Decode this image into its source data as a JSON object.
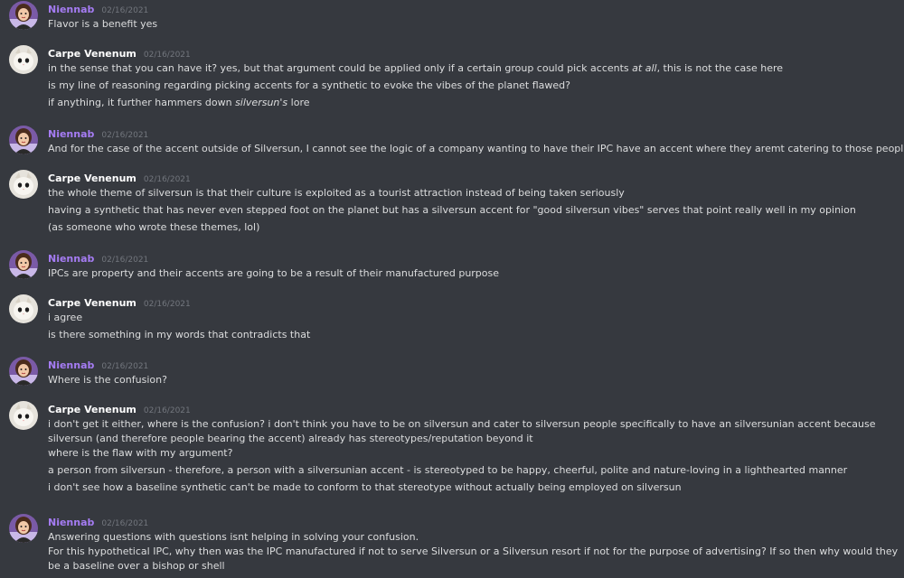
{
  "channel": {
    "messages": [
      {
        "author": "Niennab",
        "author_style": "niennab",
        "timestamp": "02/16/2021",
        "lines": [
          {
            "parts": [
              {
                "text": "Flavor is a benefit yes"
              }
            ]
          }
        ]
      },
      {
        "author": "Carpe Venenum",
        "author_style": "carpe",
        "timestamp": "02/16/2021",
        "lines": [
          {
            "parts": [
              {
                "text": "in the sense that you can have it? yes, but that argument could be applied only if a certain group could pick accents "
              },
              {
                "text": "at all",
                "italic": true
              },
              {
                "text": ", this is not the case here"
              }
            ]
          },
          {
            "parts": [
              {
                "text": "is my line of reasoning regarding picking accents for a synthetic to evoke the vibes of the planet flawed?"
              }
            ]
          },
          {
            "parts": [
              {
                "text": "if anything, it further hammers down "
              },
              {
                "text": "silversun's",
                "italic": true
              },
              {
                "text": " lore"
              }
            ]
          }
        ]
      },
      {
        "author": "Niennab",
        "author_style": "niennab",
        "timestamp": "02/16/2021",
        "lines": [
          {
            "parts": [
              {
                "text": "And for the case of the accent outside of Silversun, I cannot see the logic of a company wanting to have their IPC have an accent where they aremt catering to those people"
              }
            ]
          }
        ]
      },
      {
        "author": "Carpe Venenum",
        "author_style": "carpe",
        "timestamp": "02/16/2021",
        "lines": [
          {
            "parts": [
              {
                "text": "the whole theme of silversun is that their culture is exploited as a tourist attraction instead of being taken seriously"
              }
            ]
          },
          {
            "parts": [
              {
                "text": "having a synthetic that has never even stepped foot on the planet but has a silversun accent for \"good silversun vibes\" serves that point really well in my opinion"
              }
            ]
          },
          {
            "parts": [
              {
                "text": "(as someone who wrote these themes, lol)"
              }
            ]
          }
        ]
      },
      {
        "author": "Niennab",
        "author_style": "niennab",
        "timestamp": "02/16/2021",
        "lines": [
          {
            "parts": [
              {
                "text": "IPCs are property and their accents are going to be a result of their manufactured purpose"
              }
            ]
          }
        ]
      },
      {
        "author": "Carpe Venenum",
        "author_style": "carpe",
        "timestamp": "02/16/2021",
        "lines": [
          {
            "parts": [
              {
                "text": "i agree"
              }
            ]
          },
          {
            "parts": [
              {
                "text": "is there something in my words that contradicts that"
              }
            ]
          }
        ]
      },
      {
        "author": "Niennab",
        "author_style": "niennab",
        "timestamp": "02/16/2021",
        "lines": [
          {
            "parts": [
              {
                "text": "Where is the confusion?"
              }
            ]
          }
        ]
      },
      {
        "author": "Carpe Venenum",
        "author_style": "carpe",
        "timestamp": "02/16/2021",
        "lines": [
          {
            "parts": [
              {
                "text": "i don't get it either, where is the confusion? i don't think you have to be on silversun and cater to silversun people specifically to have an silversunian accent because silversun (and therefore people bearing the accent) already has stereotypes/reputation beyond it"
              }
            ]
          },
          {
            "parts": [
              {
                "text": "where is the flaw with my argument?"
              }
            ]
          },
          {
            "parts": [
              {
                "text": "a person from silversun - therefore, a person with a silversunian accent - is stereotyped to be happy, cheerful, polite and nature-loving in a lighthearted manner"
              }
            ]
          },
          {
            "parts": [
              {
                "text": "i don't see how a baseline synthetic can't be made to conform to that stereotype without actually being employed on silversun"
              }
            ]
          }
        ]
      },
      {
        "author": "Niennab",
        "author_style": "niennab",
        "timestamp": "02/16/2021",
        "lines": [
          {
            "parts": [
              {
                "text": "Answering questions with questions isnt helping in solving your confusion."
              }
            ]
          },
          {
            "parts": [
              {
                "text": "For this hypothetical IPC, why then was the IPC manufactured if not to serve Silversun or a Silversun resort if not for the purpose of advertising? If so then why would they be a baseline over a bishop or shell"
              }
            ]
          }
        ]
      }
    ]
  }
}
